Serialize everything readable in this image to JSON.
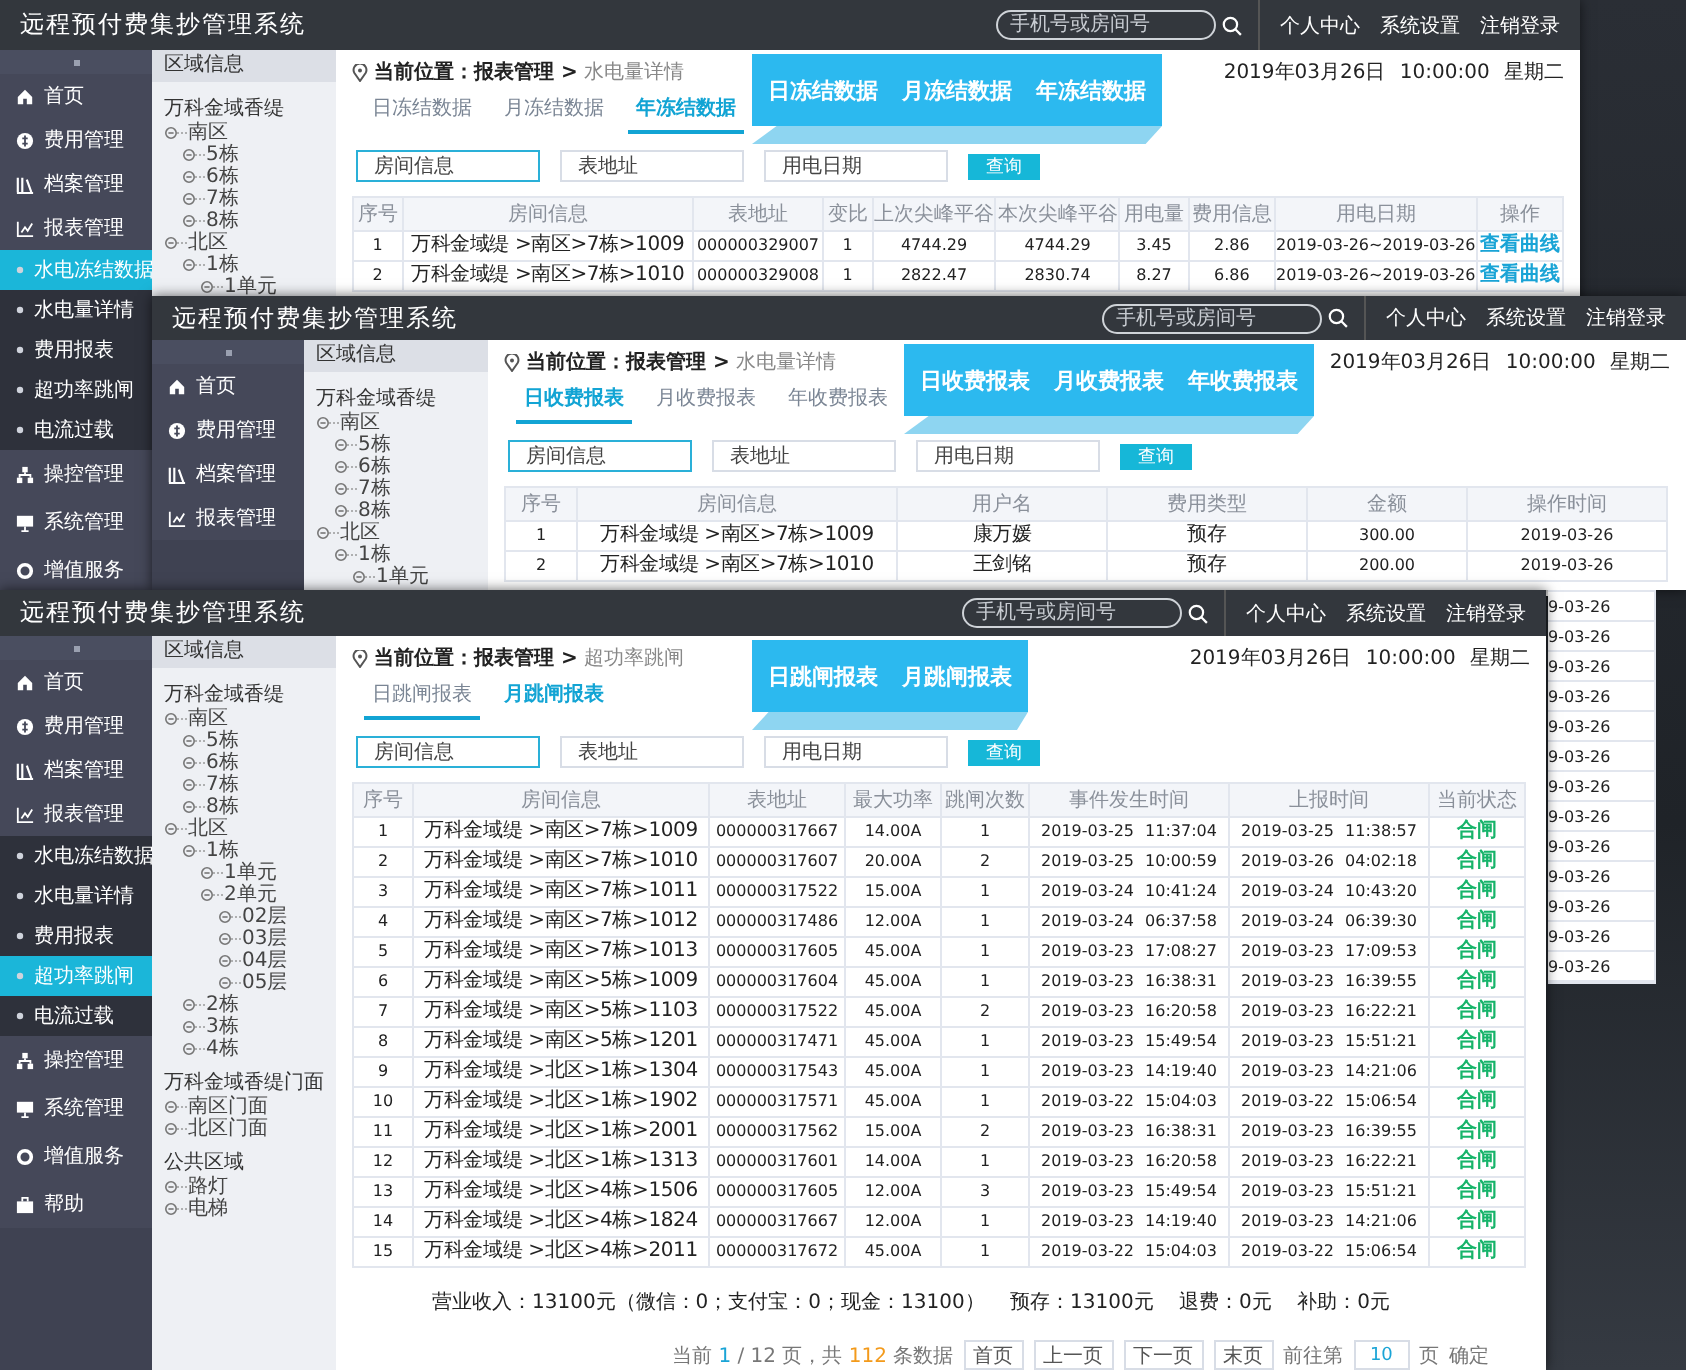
{
  "windows": [
    {
      "title": "远程预付费集抄管理系统",
      "search_placeholder": "手机号或房间号",
      "header_links": [
        "个人中心",
        "系统设置",
        "注销登录"
      ],
      "sidebar": [
        {
          "label": "首页",
          "kind": "main",
          "selected": false
        },
        {
          "label": "费用管理",
          "kind": "main",
          "selected": false
        },
        {
          "label": "档案管理",
          "kind": "main",
          "selected": false
        },
        {
          "label": "报表管理",
          "kind": "main",
          "selected": false
        },
        {
          "label": "水电冻结数据",
          "kind": "sub",
          "selected": true
        },
        {
          "label": "水电量详情",
          "kind": "sub",
          "selected": false
        },
        {
          "label": "费用报表",
          "kind": "sub",
          "selected": false
        },
        {
          "label": "超功率跳闸",
          "kind": "sub",
          "selected": false
        },
        {
          "label": "电流过载",
          "kind": "sub",
          "selected": false
        },
        {
          "label": "操控管理",
          "kind": "main",
          "selected": false
        },
        {
          "label": "系统管理",
          "kind": "main",
          "selected": false
        },
        {
          "label": "增值服务",
          "kind": "main",
          "selected": false
        }
      ],
      "tree": {
        "title": "区域信息",
        "items": [
          {
            "label": "万科金域香缇",
            "children": [
              {
                "label": "南区",
                "children": [
                  {
                    "label": "5栋"
                  },
                  {
                    "label": "6栋"
                  },
                  {
                    "label": "7栋"
                  },
                  {
                    "label": "8栋"
                  }
                ]
              },
              {
                "label": "北区",
                "children": [
                  {
                    "label": "1栋",
                    "children": [
                      {
                        "label": "1单元"
                      }
                    ]
                  }
                ]
              }
            ]
          }
        ]
      },
      "breadcrumb": "**当前位置：报表管理 >** 水电量详情",
      "datetime": "2019年03月26日 10:00:00 星期二",
      "tabs": [
        {
          "label": "日冻结数据",
          "selected": false,
          "underlined": false
        },
        {
          "label": "月冻结数据",
          "selected": false,
          "underlined": false
        },
        {
          "label": "年冻结数据",
          "selected": true,
          "underlined": true
        }
      ],
      "banner": [
        "日冻结数据",
        "月冻结数据",
        "年冻结数据"
      ],
      "filters": [
        {
          "placeholder": "房间信息",
          "focused": true
        },
        {
          "placeholder": "表地址",
          "focused": false
        },
        {
          "placeholder": "用电日期",
          "focused": false
        }
      ],
      "query_button": "查询",
      "table": {
        "columns": [
          {
            "label": "序号",
            "kind": "num"
          },
          {
            "label": "房间信息",
            "kind": "text"
          },
          {
            "label": "表地址",
            "kind": "num"
          },
          {
            "label": "变比",
            "kind": "num"
          },
          {
            "label": "上次尖峰平谷",
            "kind": "num"
          },
          {
            "label": "本次尖峰平谷",
            "kind": "num"
          },
          {
            "label": "用电量",
            "kind": "num"
          },
          {
            "label": "费用信息",
            "kind": "num"
          },
          {
            "label": "用电日期",
            "kind": "num"
          },
          {
            "label": "操作",
            "kind": "link"
          }
        ],
        "rows": [
          [
            "1",
            "万科金域缇 >南区>7栋>1009",
            "000000329007",
            "1",
            "4744.29",
            "4744.29",
            "3.45",
            "2.86",
            "2019-03-26~2019-03-26",
            "查看曲线"
          ],
          [
            "2",
            "万科金域缇 >南区>7栋>1010",
            "000000329008",
            "1",
            "2822.47",
            "2830.74",
            "8.27",
            "6.86",
            "2019-03-26~2019-03-26",
            "查看曲线"
          ]
        ]
      }
    },
    {
      "title": "远程预付费集抄管理系统",
      "search_placeholder": "手机号或房间号",
      "header_links": [
        "个人中心",
        "系统设置",
        "注销登录"
      ],
      "sidebar": [
        {
          "label": "首页",
          "kind": "main",
          "selected": false
        },
        {
          "label": "费用管理",
          "kind": "main",
          "selected": false
        },
        {
          "label": "档案管理",
          "kind": "main",
          "selected": false
        },
        {
          "label": "报表管理",
          "kind": "main",
          "selected": false
        }
      ],
      "tree": {
        "title": "区域信息",
        "items": [
          {
            "label": "万科金域香缇",
            "children": [
              {
                "label": "南区",
                "children": [
                  {
                    "label": "5栋"
                  },
                  {
                    "label": "6栋"
                  },
                  {
                    "label": "7栋"
                  },
                  {
                    "label": "8栋"
                  }
                ]
              },
              {
                "label": "北区",
                "children": [
                  {
                    "label": "1栋",
                    "children": [
                      {
                        "label": "1单元"
                      }
                    ]
                  }
                ]
              }
            ]
          }
        ]
      },
      "breadcrumb": "**当前位置：报表管理 >** 水电量详情",
      "datetime": "2019年03月26日 10:00:00 星期二",
      "tabs": [
        {
          "label": "日收费报表",
          "selected": true,
          "underlined": true
        },
        {
          "label": "月收费报表",
          "selected": false,
          "underlined": false
        },
        {
          "label": "年收费报表",
          "selected": false,
          "underlined": false
        }
      ],
      "banner": [
        "日收费报表",
        "月收费报表",
        "年收费报表"
      ],
      "filters": [
        {
          "placeholder": "房间信息",
          "focused": true
        },
        {
          "placeholder": "表地址",
          "focused": false
        },
        {
          "placeholder": "用电日期",
          "focused": false
        }
      ],
      "query_button": "查询",
      "table": {
        "columns": [
          {
            "label": "序号",
            "kind": "num"
          },
          {
            "label": "房间信息",
            "kind": "text"
          },
          {
            "label": "用户名",
            "kind": "text"
          },
          {
            "label": "费用类型",
            "kind": "text"
          },
          {
            "label": "金额",
            "kind": "num"
          },
          {
            "label": "操作时间",
            "kind": "num"
          }
        ],
        "rows": [
          [
            "1",
            "万科金域缇 >南区>7栋>1009",
            "康万媛",
            "预存",
            "300.00",
            "2019-03-26"
          ],
          [
            "2",
            "万科金域缇 >南区>7栋>1010",
            "王剑铭",
            "预存",
            "200.00",
            "2019-03-26"
          ]
        ],
        "tail_cells": [
          "9-03-26",
          "9-03-26",
          "9-03-26",
          "9-03-26",
          "9-03-26",
          "9-03-26",
          "9-03-26",
          "9-03-26",
          "9-03-26",
          "9-03-26",
          "9-03-26",
          "9-03-26",
          "9-03-26"
        ]
      }
    },
    {
      "title": "远程预付费集抄管理系统",
      "search_placeholder": "手机号或房间号",
      "header_links": [
        "个人中心",
        "系统设置",
        "注销登录"
      ],
      "sidebar": [
        {
          "label": "首页",
          "kind": "main",
          "selected": false
        },
        {
          "label": "费用管理",
          "kind": "main",
          "selected": false
        },
        {
          "label": "档案管理",
          "kind": "main",
          "selected": false
        },
        {
          "label": "报表管理",
          "kind": "main",
          "selected": false
        },
        {
          "label": "水电冻结数据",
          "kind": "sub",
          "selected": false
        },
        {
          "label": "水电量详情",
          "kind": "sub",
          "selected": false
        },
        {
          "label": "费用报表",
          "kind": "sub",
          "selected": false
        },
        {
          "label": "超功率跳闸",
          "kind": "sub",
          "selected": true
        },
        {
          "label": "电流过载",
          "kind": "sub",
          "selected": false
        },
        {
          "label": "操控管理",
          "kind": "main",
          "selected": false
        },
        {
          "label": "系统管理",
          "kind": "main",
          "selected": false
        },
        {
          "label": "增值服务",
          "kind": "main",
          "selected": false
        },
        {
          "label": "帮助",
          "kind": "main",
          "selected": false
        }
      ],
      "tree": {
        "title": "区域信息",
        "items": [
          {
            "label": "万科金域香缇",
            "children": [
              {
                "label": "南区",
                "children": [
                  {
                    "label": "5栋"
                  },
                  {
                    "label": "6栋"
                  },
                  {
                    "label": "7栋"
                  },
                  {
                    "label": "8栋"
                  }
                ]
              },
              {
                "label": "北区",
                "children": [
                  {
                    "label": "1栋",
                    "children": [
                      {
                        "label": "1单元"
                      },
                      {
                        "label": "2单元",
                        "children": [
                          {
                            "label": "02层"
                          },
                          {
                            "label": "03层"
                          },
                          {
                            "label": "04层"
                          },
                          {
                            "label": "05层"
                          }
                        ]
                      }
                    ]
                  },
                  {
                    "label": "2栋"
                  },
                  {
                    "label": "3栋"
                  },
                  {
                    "label": "4栋"
                  }
                ]
              }
            ]
          },
          {
            "label": "万科金域香缇门面",
            "children": [
              {
                "label": "南区门面"
              },
              {
                "label": "北区门面"
              }
            ]
          },
          {
            "label": "公共区域",
            "children": [
              {
                "label": "路灯"
              },
              {
                "label": "电梯"
              }
            ]
          }
        ]
      },
      "breadcrumb": "**当前位置：报表管理 >** 超功率跳闸",
      "datetime": "2019年03月26日 10:00:00 星期二",
      "tabs": [
        {
          "label": "日跳闸报表",
          "selected": false,
          "underlined": true
        },
        {
          "label": "月跳闸报表",
          "selected": true,
          "underlined": false
        }
      ],
      "banner": [
        "日跳闸报表",
        "月跳闸报表"
      ],
      "filters": [
        {
          "placeholder": "房间信息",
          "focused": true
        },
        {
          "placeholder": "表地址",
          "focused": false
        },
        {
          "placeholder": "用电日期",
          "focused": false
        }
      ],
      "query_button": "查询",
      "table": {
        "columns": [
          {
            "label": "序号",
            "kind": "num"
          },
          {
            "label": "房间信息",
            "kind": "text"
          },
          {
            "label": "表地址",
            "kind": "num"
          },
          {
            "label": "最大功率",
            "kind": "num"
          },
          {
            "label": "跳闸次数",
            "kind": "num"
          },
          {
            "label": "事件发生时间",
            "kind": "num"
          },
          {
            "label": "上报时间",
            "kind": "num"
          },
          {
            "label": "当前状态",
            "kind": "status"
          }
        ],
        "rows": [
          [
            "1",
            "万科金域缇 >南区>7栋>1009",
            "000000317667",
            "14.00A",
            "1",
            "2019-03-25 11:37:04",
            "2019-03-25 11:38:57",
            "合闸"
          ],
          [
            "2",
            "万科金域缇 >南区>7栋>1010",
            "000000317607",
            "20.00A",
            "2",
            "2019-03-25 10:00:59",
            "2019-03-26 04:02:18",
            "合闸"
          ],
          [
            "3",
            "万科金域缇 >南区>7栋>1011",
            "000000317522",
            "15.00A",
            "1",
            "2019-03-24 10:41:24",
            "2019-03-24 10:43:20",
            "合闸"
          ],
          [
            "4",
            "万科金域缇 >南区>7栋>1012",
            "000000317486",
            "12.00A",
            "1",
            "2019-03-24 06:37:58",
            "2019-03-24 06:39:30",
            "合闸"
          ],
          [
            "5",
            "万科金域缇 >南区>7栋>1013",
            "000000317605",
            "45.00A",
            "1",
            "2019-03-23 17:08:27",
            "2019-03-23 17:09:53",
            "合闸"
          ],
          [
            "6",
            "万科金域缇 >南区>5栋>1009",
            "000000317604",
            "45.00A",
            "1",
            "2019-03-23 16:38:31",
            "2019-03-23 16:39:55",
            "合闸"
          ],
          [
            "7",
            "万科金域缇 >南区>5栋>1103",
            "000000317522",
            "45.00A",
            "2",
            "2019-03-23 16:20:58",
            "2019-03-23 16:22:21",
            "合闸"
          ],
          [
            "8",
            "万科金域缇 >南区>5栋>1201",
            "000000317471",
            "45.00A",
            "1",
            "2019-03-23 15:49:54",
            "2019-03-23 15:51:21",
            "合闸"
          ],
          [
            "9",
            "万科金域缇 >北区>1栋>1304",
            "000000317543",
            "45.00A",
            "1",
            "2019-03-23 14:19:40",
            "2019-03-23 14:21:06",
            "合闸"
          ],
          [
            "10",
            "万科金域缇 >北区>1栋>1902",
            "000000317571",
            "45.00A",
            "1",
            "2019-03-22 15:04:03",
            "2019-03-22 15:06:54",
            "合闸"
          ],
          [
            "11",
            "万科金域缇 >北区>1栋>2001",
            "000000317562",
            "15.00A",
            "2",
            "2019-03-23 16:38:31",
            "2019-03-23 16:39:55",
            "合闸"
          ],
          [
            "12",
            "万科金域缇 >北区>1栋>1313",
            "000000317601",
            "14.00A",
            "1",
            "2019-03-23 16:20:58",
            "2019-03-23 16:22:21",
            "合闸"
          ],
          [
            "13",
            "万科金域缇 >北区>4栋>1506",
            "000000317605",
            "12.00A",
            "3",
            "2019-03-23 15:49:54",
            "2019-03-23 15:51:21",
            "合闸"
          ],
          [
            "14",
            "万科金域缇 >北区>4栋>1824",
            "000000317667",
            "12.00A",
            "1",
            "2019-03-23 14:19:40",
            "2019-03-23 14:21:06",
            "合闸"
          ],
          [
            "15",
            "万科金域缇 >北区>4栋>2011",
            "000000317672",
            "45.00A",
            "1",
            "2019-03-22 15:04:03",
            "2019-03-22 15:06:54",
            "合闸"
          ]
        ]
      },
      "summary": [
        "营业收入：13100元（微信：0；支付宝：0；现金：13100）",
        "预存：13100元",
        "退费：0元",
        "补助：0元"
      ],
      "pager": {
        "prefix": "当前",
        "current": "1",
        "middle": "/ 12 页，共",
        "total": "112",
        "suffix": "条数据",
        "buttons": [
          "首页",
          "上一页",
          "下一页",
          "末页"
        ],
        "goto_label": "前往第",
        "goto_value": "10",
        "goto_unit": "页",
        "confirm": "确定"
      }
    }
  ]
}
